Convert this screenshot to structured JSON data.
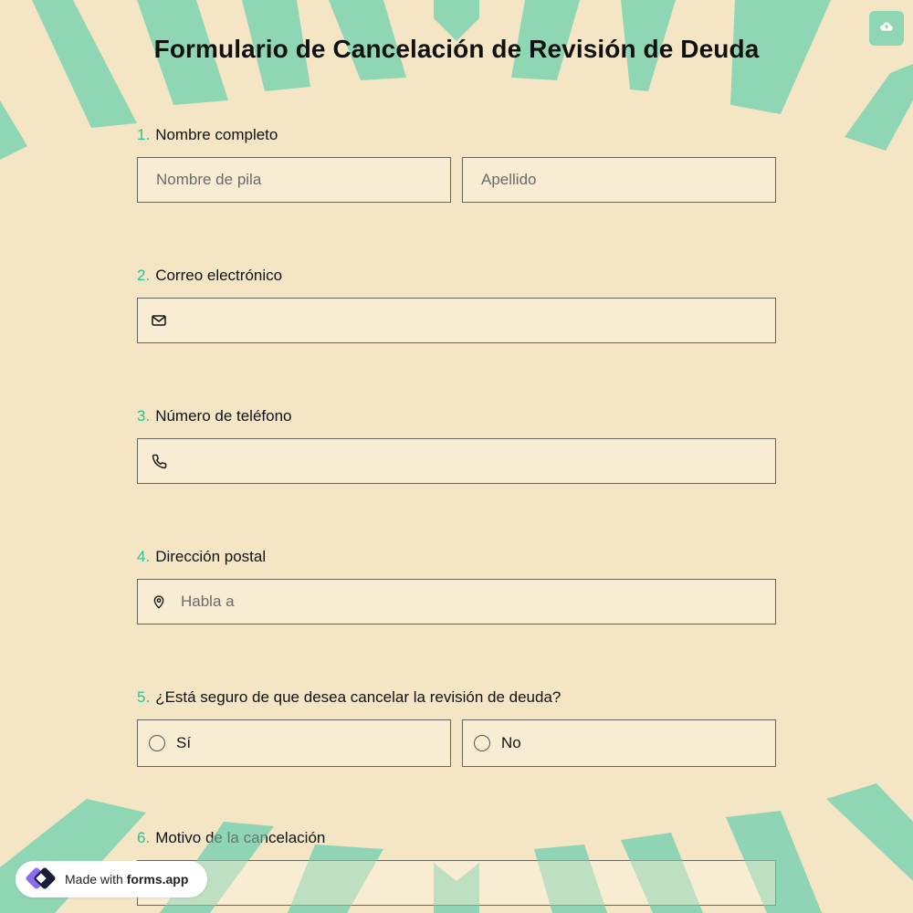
{
  "form": {
    "title": "Formulario de Cancelación de Revisión de Deuda"
  },
  "toolbar": {
    "cloud_icon": "cloud-upload-icon"
  },
  "questions": [
    {
      "number": "1.",
      "label": "Nombre completo",
      "fields": [
        {
          "placeholder": "Nombre de pila",
          "value": ""
        },
        {
          "placeholder": "Apellido",
          "value": ""
        }
      ]
    },
    {
      "number": "2.",
      "label": "Correo electrónico",
      "icon": "mail-icon",
      "placeholder": "",
      "value": ""
    },
    {
      "number": "3.",
      "label": "Número de teléfono",
      "icon": "phone-icon",
      "placeholder": "",
      "value": ""
    },
    {
      "number": "4.",
      "label": "Dirección postal",
      "icon": "map-pin-icon",
      "placeholder": "Habla a",
      "value": ""
    },
    {
      "number": "5.",
      "label": "¿Está seguro de que desea cancelar la revisión de deuda?",
      "options": [
        "Sí",
        "No"
      ]
    },
    {
      "number": "6.",
      "label": "Motivo de la cancelación",
      "placeholder": "",
      "value": ""
    }
  ],
  "badge": {
    "prefix": "Made with",
    "brand": "forms.app",
    "logo_icon": "forms-app-logo-icon"
  },
  "colors": {
    "background": "#f4e6c5",
    "accent": "#27c298",
    "stripe": "#8fd6b5",
    "field_bg": "#f8ecd3"
  }
}
